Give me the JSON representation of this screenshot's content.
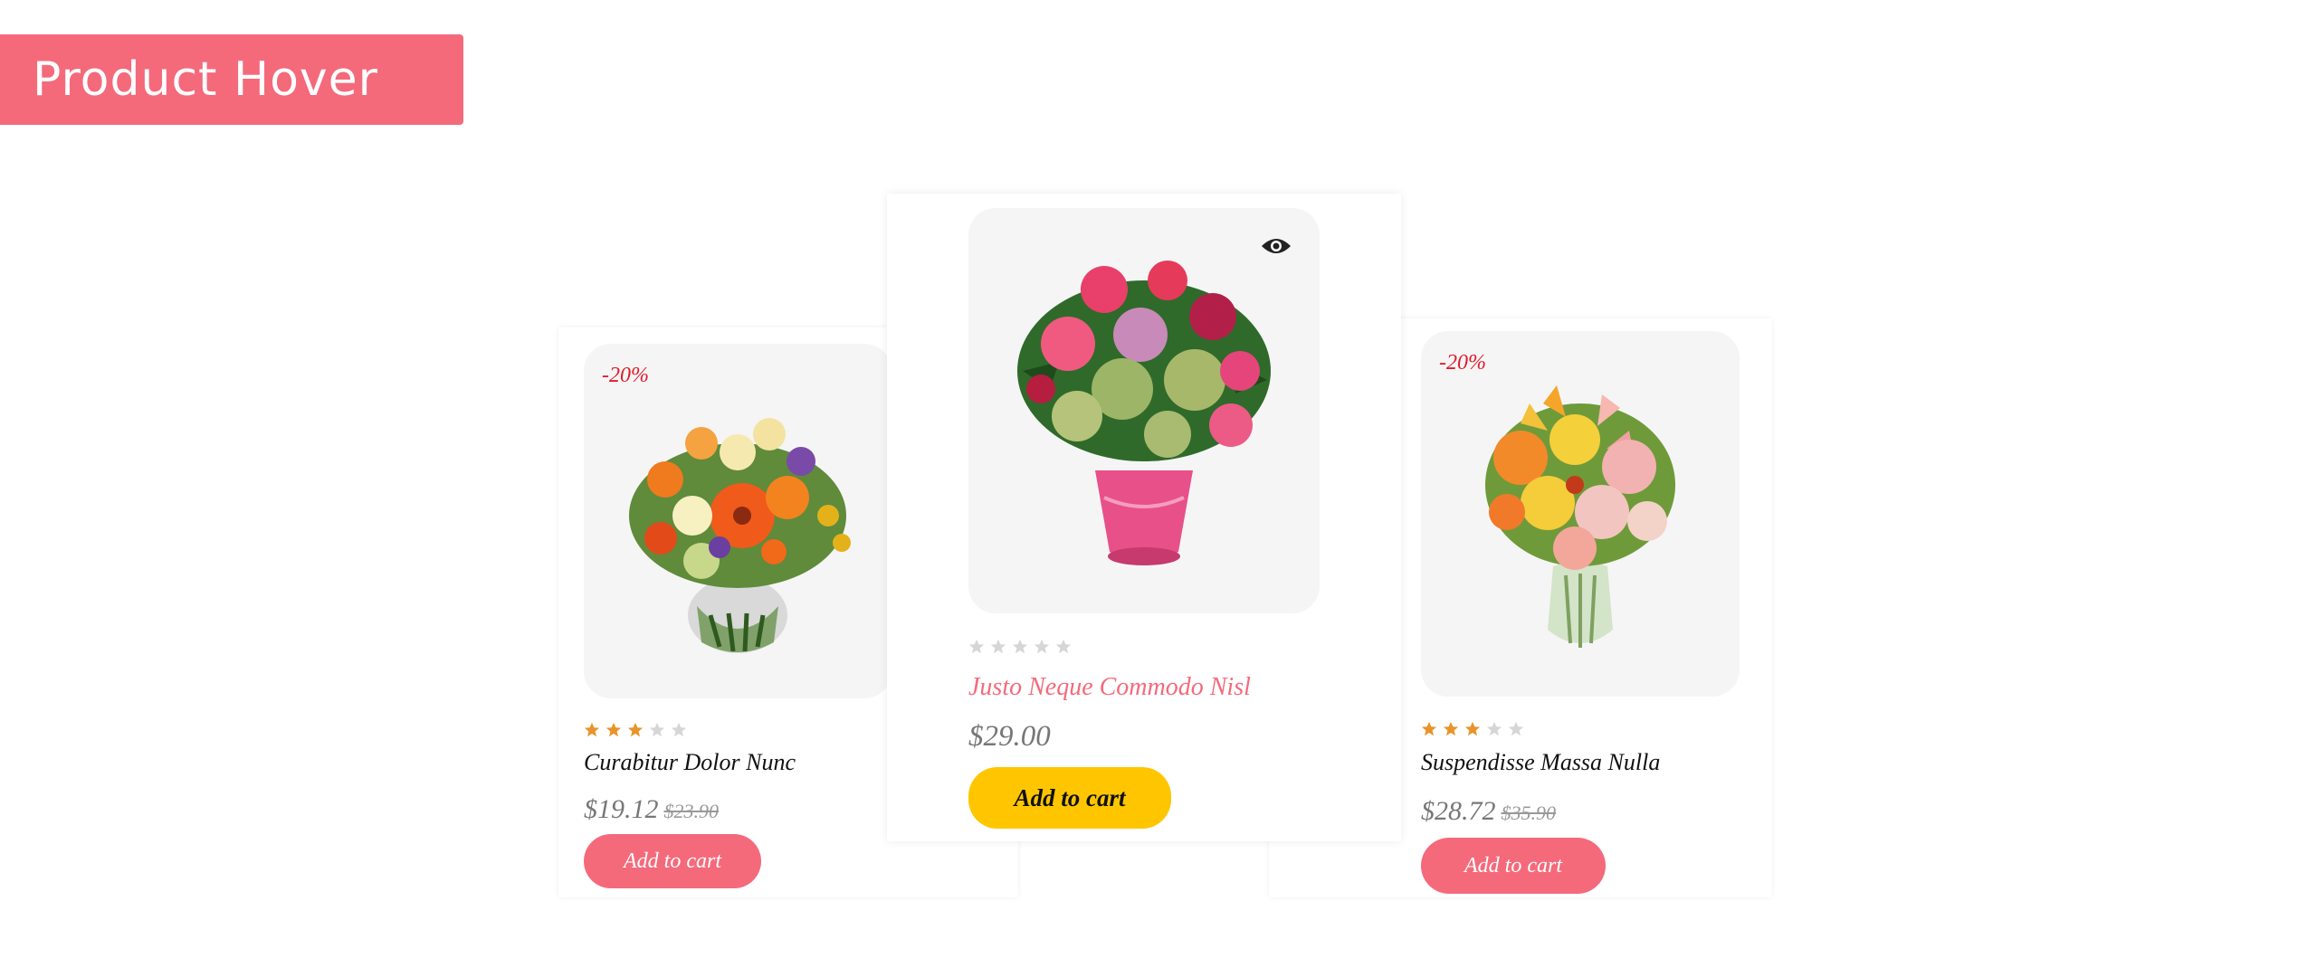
{
  "banner": {
    "title": "Product Hover"
  },
  "colors": {
    "accent": "#f46a7b",
    "badge": "#e01a2b",
    "cart_active": "#ffc600",
    "star_filled": "#e8942a",
    "star_empty": "#d6d6d6"
  },
  "products": [
    {
      "badge": "-20%",
      "rating": 3,
      "name": "Curabitur Dolor Nunc",
      "price": "$19.12",
      "old_price": "$23.90",
      "cta": "Add to cart"
    },
    {
      "badge": "",
      "rating": 0,
      "name": "Justo Neque Commodo Nisl",
      "price": "$29.00",
      "old_price": "",
      "cta": "Add to cart",
      "quick_view_icon": "eye-icon"
    },
    {
      "badge": "-20%",
      "rating": 3,
      "name": "Suspendisse Massa Nulla",
      "price": "$28.72",
      "old_price": "$35.90",
      "cta": "Add to cart"
    }
  ]
}
